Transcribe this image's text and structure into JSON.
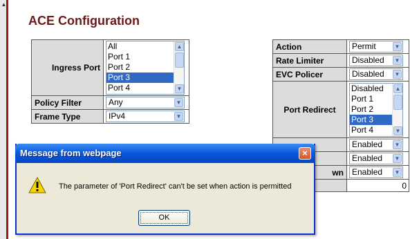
{
  "page": {
    "title": "ACE Configuration"
  },
  "ingress_port": {
    "label": "Ingress Port",
    "options": [
      "All",
      "Port 1",
      "Port 2",
      "Port 3",
      "Port 4"
    ],
    "selected": "Port 3"
  },
  "policy_filter": {
    "label": "Policy Filter",
    "value": "Any"
  },
  "frame_type": {
    "label": "Frame Type",
    "value": "IPv4"
  },
  "action": {
    "label": "Action",
    "value": "Permit"
  },
  "rate_limiter": {
    "label": "Rate Limiter",
    "value": "Disabled"
  },
  "evc_policer": {
    "label": "EVC Policer",
    "value": "Disabled"
  },
  "port_redirect": {
    "label": "Port Redirect",
    "options": [
      "Disabled",
      "Port 1",
      "Port 2",
      "Port 3",
      "Port 4"
    ],
    "selected": "Port 3"
  },
  "hidden_rows": [
    {
      "label_fragment": "",
      "value": "Enabled"
    },
    {
      "label_fragment": "",
      "value": "Enabled"
    },
    {
      "label_fragment": "wn",
      "value": "Enabled"
    }
  ],
  "counter_value": "0",
  "dialog": {
    "title": "Message from webpage",
    "message": "The parameter of 'Port Redirect' can't be set when action is permitted",
    "ok_label": "OK",
    "close_glyph": "×"
  },
  "colors": {
    "title": "#6b1a1a",
    "label_bg": "#dcdcdc",
    "selection": "#316ac5",
    "dialog_titlebar": "#0a56d8",
    "dialog_body": "#ece9d8"
  }
}
